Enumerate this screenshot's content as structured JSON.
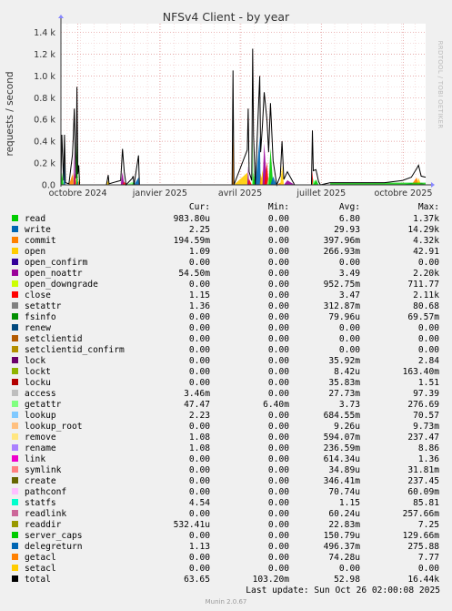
{
  "title": "NFSv4 Client - by year",
  "ylabel": "requests / second",
  "watermark": "RRDTOOL / TOBI OETIKER",
  "footer": "Last update:  Sun Oct 26 02:00:08 2025",
  "munin": "Munin 2.0.67",
  "table_headers": [
    "Cur:",
    "Min:",
    "Avg:",
    "Max:"
  ],
  "chart_data": {
    "type": "area",
    "title": "NFSv4 Client - by year",
    "ylabel": "requests / second",
    "x_tick_labels": [
      "octobre 2024",
      "janvier 2025",
      "avril 2025",
      "juillet 2025",
      "octobre 2025"
    ],
    "x_tick_dates": [
      "2024-10-01",
      "2025-01-01",
      "2025-04-01",
      "2025-07-01",
      "2025-10-01"
    ],
    "x_range": [
      "2024-09-12",
      "2025-10-26"
    ],
    "y_tick_labels": [
      "0.0",
      "0.2 k",
      "0.4 k",
      "0.6 k",
      "0.8 k",
      "1.0 k",
      "1.2 k",
      "1.4 k"
    ],
    "y_ticks": [
      0,
      200,
      400,
      600,
      800,
      1000,
      1200,
      1400
    ],
    "ylim": [
      0,
      1480
    ],
    "grid": true,
    "series_total_points": [
      [
        "2024-09-12",
        0
      ],
      [
        "2024-09-13",
        460
      ],
      [
        "2024-09-15",
        40
      ],
      [
        "2024-09-16",
        460
      ],
      [
        "2024-09-17",
        20
      ],
      [
        "2024-09-21",
        10
      ],
      [
        "2024-09-25",
        280
      ],
      [
        "2024-09-26",
        460
      ],
      [
        "2024-09-27",
        700
      ],
      [
        "2024-09-28",
        300
      ],
      [
        "2024-09-29",
        60
      ],
      [
        "2024-09-30",
        900
      ],
      [
        "2024-10-01",
        100
      ],
      [
        "2024-10-02",
        180
      ],
      [
        "2024-10-03",
        0
      ],
      [
        "2024-11-02",
        0
      ],
      [
        "2024-11-04",
        90
      ],
      [
        "2024-11-05",
        10
      ],
      [
        "2024-11-18",
        40
      ],
      [
        "2024-11-20",
        330
      ],
      [
        "2024-11-22",
        120
      ],
      [
        "2024-11-24",
        0
      ],
      [
        "2024-12-01",
        60
      ],
      [
        "2024-12-02",
        80
      ],
      [
        "2024-12-03",
        0
      ],
      [
        "2024-12-08",
        270
      ],
      [
        "2024-12-09",
        0
      ],
      [
        "2025-03-23",
        0
      ],
      [
        "2025-03-24",
        1050
      ],
      [
        "2025-03-25",
        0
      ],
      [
        "2025-04-09",
        320
      ],
      [
        "2025-04-10",
        700
      ],
      [
        "2025-04-11",
        120
      ],
      [
        "2025-04-14",
        40
      ],
      [
        "2025-04-15",
        1250
      ],
      [
        "2025-04-16",
        450
      ],
      [
        "2025-04-18",
        0
      ],
      [
        "2025-04-23",
        1000
      ],
      [
        "2025-04-24",
        300
      ],
      [
        "2025-04-26",
        550
      ],
      [
        "2025-04-28",
        850
      ],
      [
        "2025-05-01",
        600
      ],
      [
        "2025-05-03",
        300
      ],
      [
        "2025-05-05",
        750
      ],
      [
        "2025-05-08",
        220
      ],
      [
        "2025-05-12",
        0
      ],
      [
        "2025-05-16",
        80
      ],
      [
        "2025-05-18",
        400
      ],
      [
        "2025-05-20",
        50
      ],
      [
        "2025-05-24",
        120
      ],
      [
        "2025-06-01",
        0
      ],
      [
        "2025-06-20",
        0
      ],
      [
        "2025-06-21",
        500
      ],
      [
        "2025-06-22",
        130
      ],
      [
        "2025-06-25",
        140
      ],
      [
        "2025-06-28",
        30
      ],
      [
        "2025-06-30",
        0
      ],
      [
        "2025-07-11",
        20
      ],
      [
        "2025-07-21",
        20
      ],
      [
        "2025-09-10",
        20
      ],
      [
        "2025-09-30",
        40
      ],
      [
        "2025-10-10",
        70
      ],
      [
        "2025-10-16",
        150
      ],
      [
        "2025-10-18",
        180
      ],
      [
        "2025-10-21",
        80
      ],
      [
        "2025-10-26",
        70
      ]
    ],
    "series": [
      {
        "name": "read",
        "color": "#00cc00",
        "cur": "983.80u",
        "min": "0.00",
        "avg": "6.80",
        "max": "1.37k"
      },
      {
        "name": "write",
        "color": "#0066b3",
        "cur": "2.25",
        "min": "0.00",
        "avg": "29.93",
        "max": "14.29k"
      },
      {
        "name": "commit",
        "color": "#ff8000",
        "cur": "194.59m",
        "min": "0.00",
        "avg": "397.96m",
        "max": "4.32k"
      },
      {
        "name": "open",
        "color": "#ffcc00",
        "cur": "1.09",
        "min": "0.00",
        "avg": "266.93m",
        "max": "42.91"
      },
      {
        "name": "open_confirm",
        "color": "#330099",
        "cur": "0.00",
        "min": "0.00",
        "avg": "0.00",
        "max": "0.00"
      },
      {
        "name": "open_noattr",
        "color": "#990099",
        "cur": "54.50m",
        "min": "0.00",
        "avg": "3.49",
        "max": "2.20k"
      },
      {
        "name": "open_downgrade",
        "color": "#ccff00",
        "cur": "0.00",
        "min": "0.00",
        "avg": "952.75m",
        "max": "711.77"
      },
      {
        "name": "close",
        "color": "#ff0000",
        "cur": "1.15",
        "min": "0.00",
        "avg": "3.47",
        "max": "2.11k"
      },
      {
        "name": "setattr",
        "color": "#808080",
        "cur": "1.36",
        "min": "0.00",
        "avg": "312.87m",
        "max": "80.68"
      },
      {
        "name": "fsinfo",
        "color": "#008f00",
        "cur": "0.00",
        "min": "0.00",
        "avg": "79.96u",
        "max": "69.57m"
      },
      {
        "name": "renew",
        "color": "#00487d",
        "cur": "0.00",
        "min": "0.00",
        "avg": "0.00",
        "max": "0.00"
      },
      {
        "name": "setclientid",
        "color": "#b35a00",
        "cur": "0.00",
        "min": "0.00",
        "avg": "0.00",
        "max": "0.00"
      },
      {
        "name": "setclientid_confirm",
        "color": "#b38f00",
        "cur": "0.00",
        "min": "0.00",
        "avg": "0.00",
        "max": "0.00"
      },
      {
        "name": "lock",
        "color": "#6b006b",
        "cur": "0.00",
        "min": "0.00",
        "avg": "35.92m",
        "max": "2.84"
      },
      {
        "name": "lockt",
        "color": "#8fb300",
        "cur": "0.00",
        "min": "0.00",
        "avg": "8.42u",
        "max": "163.40m"
      },
      {
        "name": "locku",
        "color": "#b30000",
        "cur": "0.00",
        "min": "0.00",
        "avg": "35.83m",
        "max": "1.51"
      },
      {
        "name": "access",
        "color": "#bebebe",
        "cur": "3.46m",
        "min": "0.00",
        "avg": "27.73m",
        "max": "97.39"
      },
      {
        "name": "getattr",
        "color": "#80ff80",
        "cur": "47.47",
        "min": "6.40m",
        "avg": "3.73",
        "max": "276.69"
      },
      {
        "name": "lookup",
        "color": "#80c9ff",
        "cur": "2.23",
        "min": "0.00",
        "avg": "684.55m",
        "max": "70.57"
      },
      {
        "name": "lookup_root",
        "color": "#ffc080",
        "cur": "0.00",
        "min": "0.00",
        "avg": "9.26u",
        "max": "9.73m"
      },
      {
        "name": "remove",
        "color": "#ffe680",
        "cur": "1.08",
        "min": "0.00",
        "avg": "594.07m",
        "max": "237.47"
      },
      {
        "name": "rename",
        "color": "#aa80ff",
        "cur": "1.08",
        "min": "0.00",
        "avg": "236.59m",
        "max": "8.86"
      },
      {
        "name": "link",
        "color": "#ee00cc",
        "cur": "0.00",
        "min": "0.00",
        "avg": "614.34u",
        "max": "1.36"
      },
      {
        "name": "symlink",
        "color": "#ff8080",
        "cur": "0.00",
        "min": "0.00",
        "avg": "34.89u",
        "max": "31.81m"
      },
      {
        "name": "create",
        "color": "#666600",
        "cur": "0.00",
        "min": "0.00",
        "avg": "346.41m",
        "max": "237.45"
      },
      {
        "name": "pathconf",
        "color": "#ffbfff",
        "cur": "0.00",
        "min": "0.00",
        "avg": "70.74u",
        "max": "60.09m"
      },
      {
        "name": "statfs",
        "color": "#00ffcc",
        "cur": "4.54",
        "min": "0.00",
        "avg": "1.15",
        "max": "85.81"
      },
      {
        "name": "readlink",
        "color": "#cc6699",
        "cur": "0.00",
        "min": "0.00",
        "avg": "60.24u",
        "max": "257.66m"
      },
      {
        "name": "readdir",
        "color": "#999900",
        "cur": "532.41u",
        "min": "0.00",
        "avg": "22.83m",
        "max": "7.25"
      },
      {
        "name": "server_caps",
        "color": "#00cc00",
        "cur": "0.00",
        "min": "0.00",
        "avg": "150.79u",
        "max": "129.66m"
      },
      {
        "name": "delegreturn",
        "color": "#0066b3",
        "cur": "1.13",
        "min": "0.00",
        "avg": "496.37m",
        "max": "275.88"
      },
      {
        "name": "getacl",
        "color": "#ff8000",
        "cur": "0.00",
        "min": "0.00",
        "avg": "74.28u",
        "max": "7.77"
      },
      {
        "name": "setacl",
        "color": "#ffcc00",
        "cur": "0.00",
        "min": "0.00",
        "avg": "0.00",
        "max": "0.00"
      },
      {
        "name": "total",
        "color": "#000000",
        "cur": "63.65",
        "min": "103.20m",
        "avg": "52.98",
        "max": "16.44k"
      }
    ]
  }
}
